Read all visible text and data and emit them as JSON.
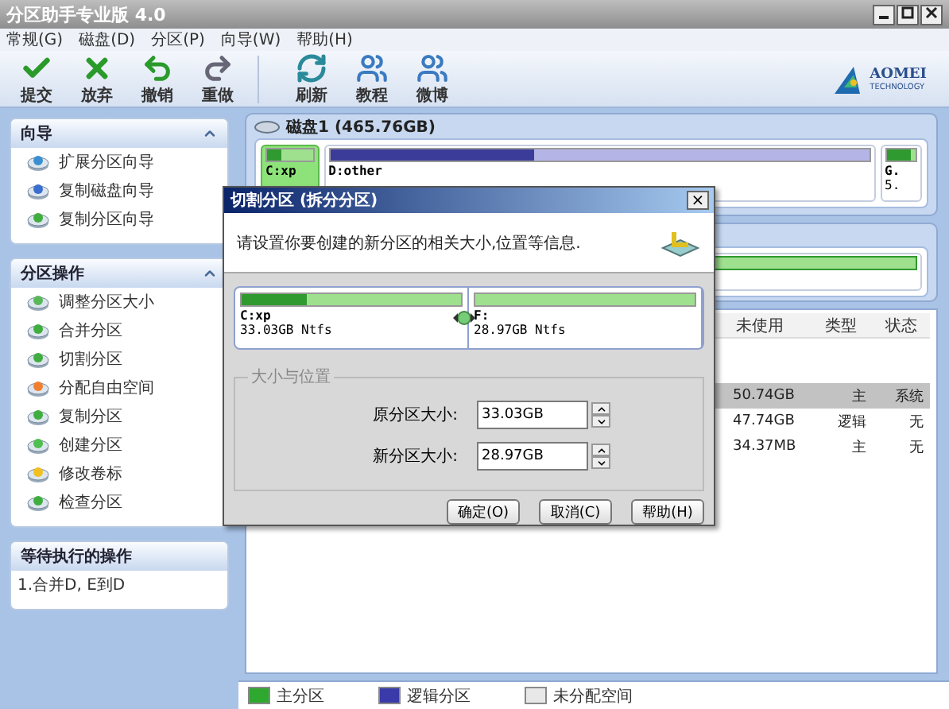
{
  "window": {
    "title": "分区助手专业版 4.0"
  },
  "menu": [
    "常规(G)",
    "磁盘(D)",
    "分区(P)",
    "向导(W)",
    "帮助(H)"
  ],
  "toolbar": [
    {
      "label": "提交",
      "kind": "check"
    },
    {
      "label": "放弃",
      "kind": "cross"
    },
    {
      "label": "撤销",
      "kind": "undo"
    },
    {
      "label": "重做",
      "kind": "redo"
    },
    {
      "label": "刷新",
      "kind": "refresh",
      "group_start": true
    },
    {
      "label": "教程",
      "kind": "people"
    },
    {
      "label": "微博",
      "kind": "people"
    }
  ],
  "logo": {
    "name": "AOMEI",
    "tagline": "TECHNOLOGY"
  },
  "sidebar": [
    {
      "title": "向导",
      "items": [
        "扩展分区向导",
        "复制磁盘向导",
        "复制分区向导"
      ]
    },
    {
      "title": "分区操作",
      "items": [
        "调整分区大小",
        "合并分区",
        "切割分区",
        "分配自由空间",
        "复制分区",
        "创建分区",
        "修改卷标",
        "检查分区"
      ]
    }
  ],
  "pending": {
    "title": "等待执行的操作",
    "items": [
      "1.合并D, E到D"
    ]
  },
  "disk": {
    "title": "磁盘1 (465.76GB)",
    "partitions": [
      {
        "label": "C:xp",
        "kind": "primary",
        "level": 0.3,
        "selected": true
      },
      {
        "label": "D:other",
        "kind": "logical",
        "level": 0.38,
        "selected": false
      },
      {
        "label": "G.",
        "detail": "5.",
        "kind": "primary",
        "level": 0.85,
        "selected": false
      }
    ]
  },
  "disk2": {
    "partitions": [
      {
        "kind": "primary",
        "level": 1
      }
    ]
  },
  "table": {
    "columns": [
      "未使用",
      "类型",
      "状态"
    ],
    "rows": [
      {
        "cells": [
          "50.74GB",
          "主",
          "系统"
        ],
        "selected": true
      },
      {
        "cells": [
          "47.74GB",
          "逻辑",
          "无"
        ],
        "selected": false
      },
      {
        "cells": [
          "34.37MB",
          "主",
          "无"
        ],
        "selected": false
      }
    ]
  },
  "legend": [
    {
      "label": "主分区",
      "color": "#2fa82f"
    },
    {
      "label": "逻辑分区",
      "color": "#3a3aa8"
    },
    {
      "label": "未分配空间",
      "color": "#e8e8e8"
    }
  ],
  "dialog": {
    "title": "切割分区 (拆分分区)",
    "close": "×",
    "message": "请设置你要创建的新分区的相关大小,位置等信息.",
    "partitions": [
      {
        "label": "C:xp",
        "detail": "33.03GB Ntfs",
        "level": 0.3
      },
      {
        "label": "F:",
        "detail": "28.97GB Ntfs",
        "level": 0
      }
    ],
    "group": "大小与位置",
    "fields": [
      {
        "label": "原分区大小:",
        "value": "33.03GB"
      },
      {
        "label": "新分区大小:",
        "value": "28.97GB"
      }
    ],
    "buttons": [
      "确定(O)",
      "取消(C)",
      "帮助(H)"
    ]
  }
}
